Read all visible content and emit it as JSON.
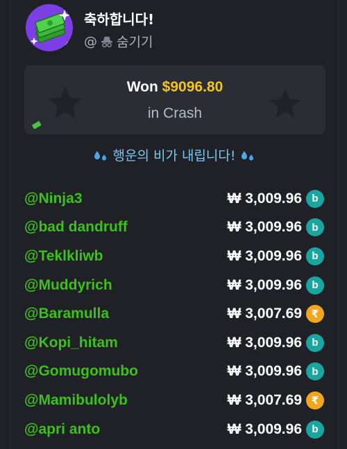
{
  "header": {
    "title": "축하합니다!",
    "handle_prefix": "@",
    "handle_name": "숨기기"
  },
  "card": {
    "won_label": "Won",
    "won_amount": "$9096.80",
    "game_text": "in Crash"
  },
  "rain_text": "행운의 비가 내립니다!",
  "colors": {
    "background": "#1f2127",
    "card": "#2a2d34",
    "username": "#3bc118",
    "amount_highlight": "#f5c518",
    "rain_text": "#79c7f2",
    "coin_b": "#1aa6a0",
    "coin_r": "#f2a51f"
  },
  "winners": [
    {
      "user": "@Ninja3",
      "amount": "₩ 3,009.96",
      "coin": "b",
      "coin_icon": "b-coin-icon"
    },
    {
      "user": "@bad dandruff",
      "amount": "₩ 3,009.96",
      "coin": "b",
      "coin_icon": "b-coin-icon"
    },
    {
      "user": "@Teklkliwb",
      "amount": "₩ 3,009.96",
      "coin": "b",
      "coin_icon": "b-coin-icon"
    },
    {
      "user": "@Muddyrich",
      "amount": "₩ 3,009.96",
      "coin": "b",
      "coin_icon": "b-coin-icon"
    },
    {
      "user": "@Baramulla",
      "amount": "₩ 3,007.69",
      "coin": "r",
      "coin_icon": "rupee-coin-icon"
    },
    {
      "user": "@Kopi_hitam",
      "amount": "₩ 3,009.96",
      "coin": "b",
      "coin_icon": "b-coin-icon"
    },
    {
      "user": "@Gomugomubo",
      "amount": "₩ 3,009.96",
      "coin": "b",
      "coin_icon": "b-coin-icon"
    },
    {
      "user": "@Mamibulolyb",
      "amount": "₩ 3,007.69",
      "coin": "r",
      "coin_icon": "rupee-coin-icon"
    },
    {
      "user": "@apri anto",
      "amount": "₩ 3,009.96",
      "coin": "b",
      "coin_icon": "b-coin-icon"
    }
  ]
}
